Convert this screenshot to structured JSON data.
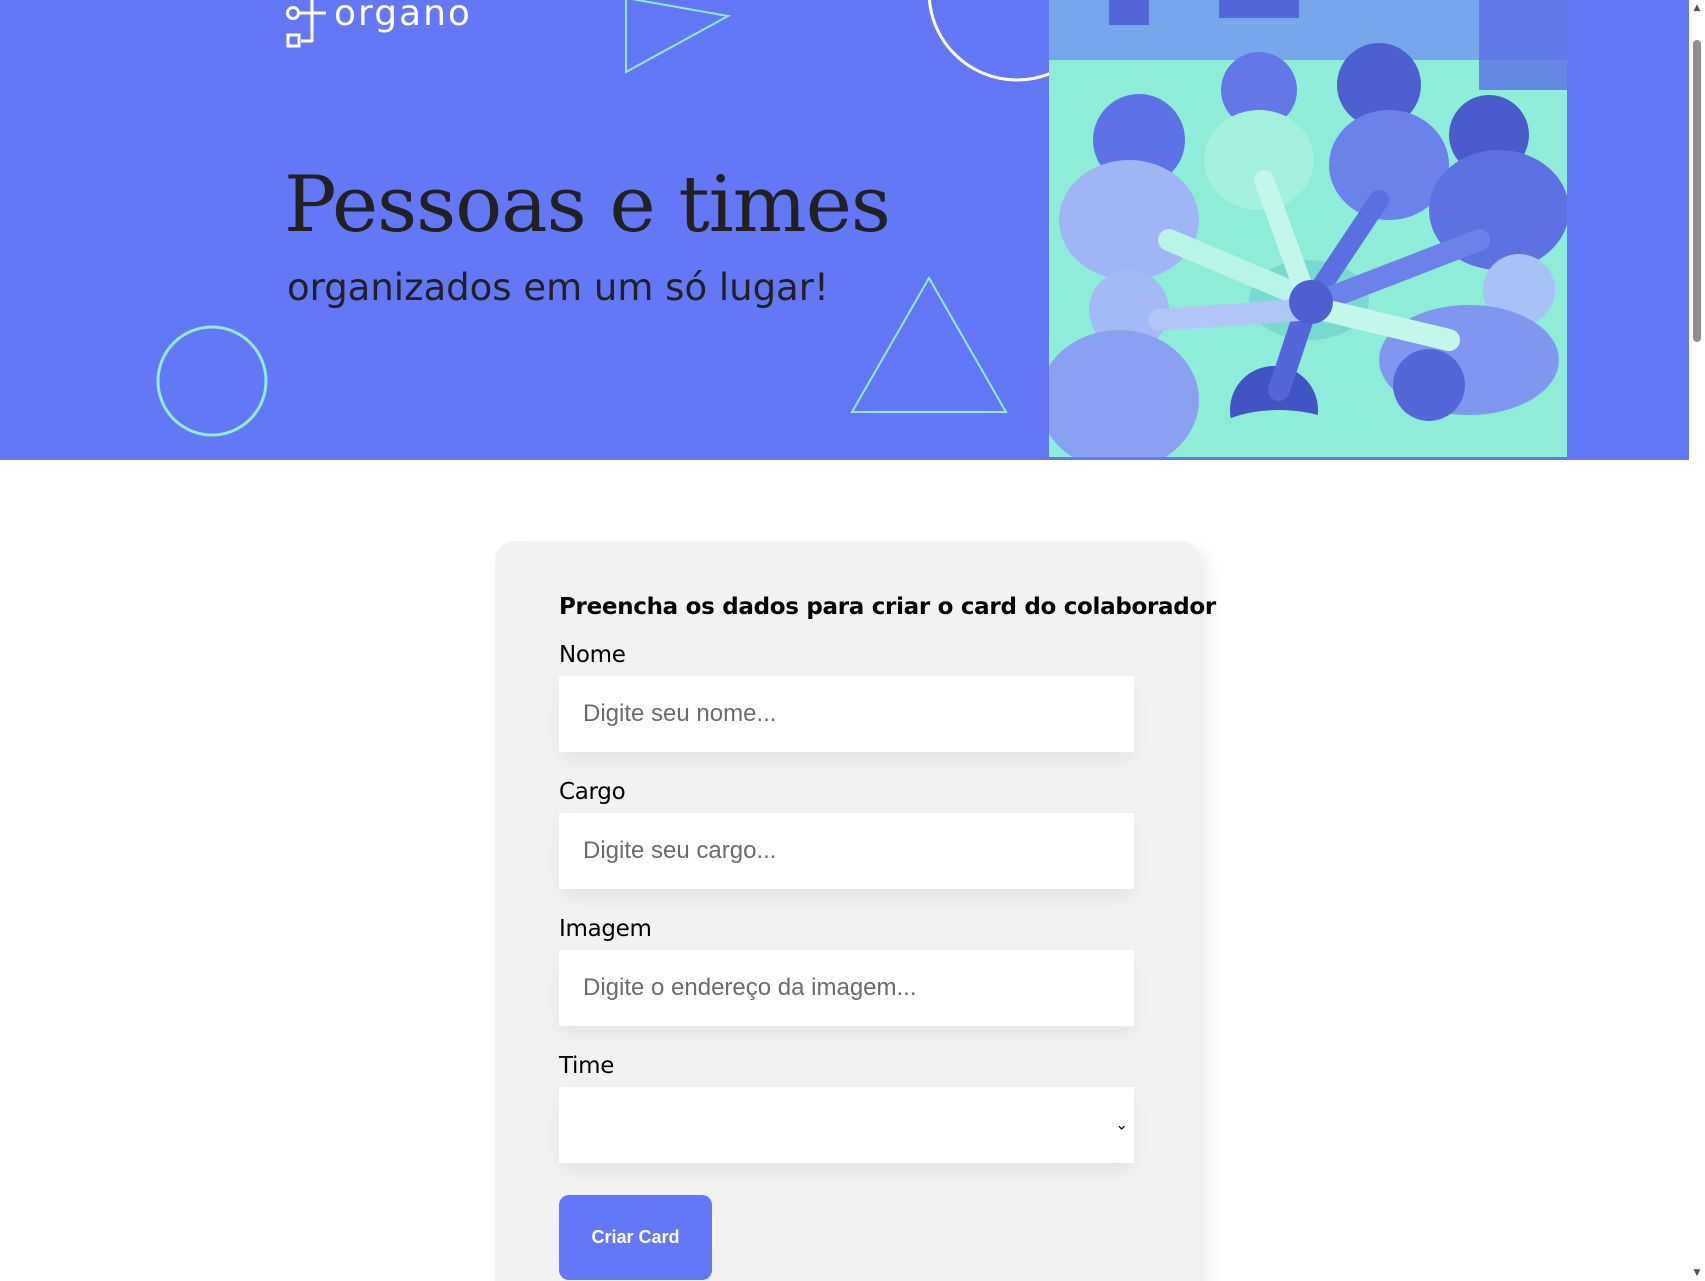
{
  "brand": {
    "name": "organo",
    "primary_color": "#6278f7",
    "accent_color": "#8eecd8"
  },
  "hero": {
    "title": "Pessoas e times",
    "subtitle": "organizados em um só lugar!",
    "image_description_icon": "team-hands-together-photo"
  },
  "form": {
    "heading": "Preencha os dados para criar o card do colaborador",
    "fields": {
      "nome": {
        "label": "Nome",
        "placeholder": "Digite seu nome...",
        "value": ""
      },
      "cargo": {
        "label": "Cargo",
        "placeholder": "Digite seu cargo...",
        "value": ""
      },
      "imagem": {
        "label": "Imagem",
        "placeholder": "Digite o endereço da imagem...",
        "value": ""
      },
      "time": {
        "label": "Time",
        "selected": ""
      }
    },
    "submit_label": "Criar Card"
  }
}
